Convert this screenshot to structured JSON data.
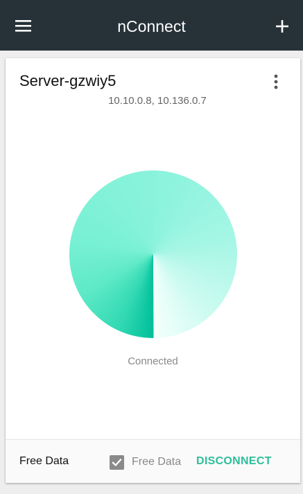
{
  "app": {
    "title": "nConnect",
    "accent_color": "#2bbf9a",
    "appbar_color": "#263238"
  },
  "toolbar": {
    "menu_icon": "hamburger-menu-icon",
    "add_icon": "plus-icon"
  },
  "server": {
    "name": "Server-gzwiy5",
    "ips": "10.10.0.8, 10.136.0.7",
    "more_icon": "more-vertical-icon"
  },
  "connection": {
    "status": "Connected",
    "status_icon": "connection-status-circle"
  },
  "footer": {
    "plan_label": "Free Data",
    "checkbox_label": "Free Data",
    "checkbox_checked": true,
    "disconnect_label": "DISCONNECT"
  }
}
